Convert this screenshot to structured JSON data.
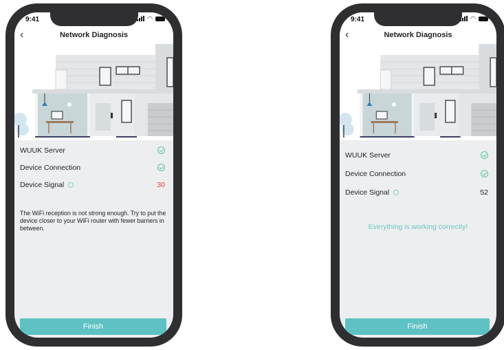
{
  "left": {
    "status_time": "9:41",
    "title": "Network Diagnosis",
    "rows": [
      {
        "label": "WUUK Server"
      },
      {
        "label": "Device Connection"
      },
      {
        "label": "Device Signal",
        "value": "30"
      }
    ],
    "message": "The WiFi reception is not strong enough. Try to put the device closer to your WiFi router with fewer barriers in between.",
    "button": "Finish"
  },
  "right": {
    "status_time": "9:41",
    "title": "Network Diagnosis",
    "rows": [
      {
        "label": "WUUK Server"
      },
      {
        "label": "Device Connection"
      },
      {
        "label": "Device Signal",
        "value": "52"
      }
    ],
    "message": "Everything is working correctly!",
    "button": "Finish"
  },
  "colors": {
    "accent": "#5ec1c4",
    "check": "#5fc39d",
    "weak_signal": "#e0403c",
    "ok_text": "#6cc7be"
  },
  "icons": [
    "back-icon",
    "check-icon",
    "help-icon",
    "signal-bars-icon",
    "wifi-icon",
    "battery-icon"
  ]
}
